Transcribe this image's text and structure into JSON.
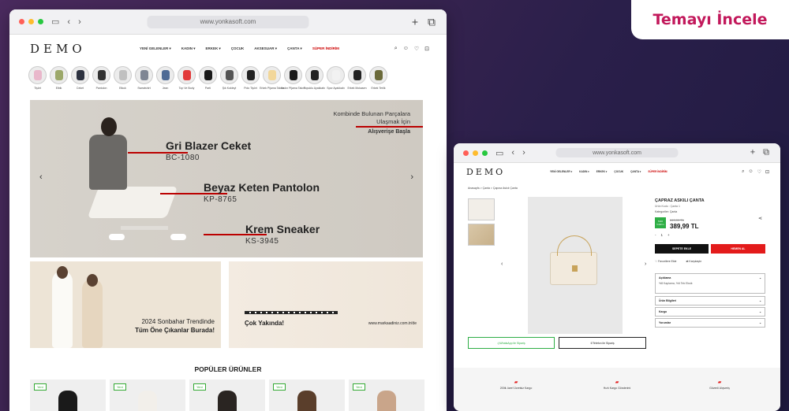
{
  "badge": {
    "label": "Temayı İncele"
  },
  "colors": {
    "accent_red": "#e31b1b",
    "badge_pink": "#c2185b",
    "green": "#2eae45"
  },
  "main_window": {
    "url": "www.yonkasoft.com",
    "logo": "DEMO",
    "nav": [
      "YENİ GELENLER ▾",
      "KADIN ▾",
      "ERKEK ▾",
      "ÇOCUK",
      "AKSESUAR ▾",
      "ÇANTA ▾",
      "SÜPER İNDİRİM"
    ],
    "header_icons": [
      "search-icon",
      "user-icon",
      "heart-icon",
      "cart-icon"
    ],
    "categories": [
      {
        "label": "Tişört",
        "color": "#e9b7cb"
      },
      {
        "label": "Elbik",
        "color": "#9ca86a"
      },
      {
        "label": "Ceket",
        "color": "#2d3240"
      },
      {
        "label": "Pantolon",
        "color": "#333"
      },
      {
        "label": "Etkuk",
        "color": "#c0c0c0"
      },
      {
        "label": "Sweatshirt",
        "color": "#7f8694"
      },
      {
        "label": "Jean",
        "color": "#4f6b95"
      },
      {
        "label": "Top Ve Body",
        "color": "#e23a3a"
      },
      {
        "label": "Parti",
        "color": "#1a1a1a"
      },
      {
        "label": "Şık Kokteyl",
        "color": "#555"
      },
      {
        "label": "Polo Tişört",
        "color": "#222"
      },
      {
        "label": "Erkek Pijama Takım",
        "color": "#f2d79a"
      },
      {
        "label": "Kadın Pijama Takım",
        "color": "#1a1a1a"
      },
      {
        "label": "Topuklu Ayakkabı",
        "color": "#222"
      },
      {
        "label": "Spor Ayakkabı",
        "color": "#f2f2f2"
      },
      {
        "label": "Erkek Mokasen",
        "color": "#222"
      },
      {
        "label": "Erkek Terlik",
        "color": "#6b6a3a"
      }
    ],
    "hero": {
      "right_text": "Kombinde Bulunan Parçalara Ulaşmak İçin",
      "cta": "Alışverişe Başla",
      "items": [
        {
          "name": "Gri Blazer Ceket",
          "code": "BC-1080"
        },
        {
          "name": "Beyaz Keten Pantolon",
          "code": "KP-8765"
        },
        {
          "name": "Krem Sneaker",
          "code": "KS-3945"
        }
      ],
      "prev_arrow": "‹",
      "next_arrow": "›"
    },
    "promo1": {
      "line1": "2024 Sonbahar Trendinde",
      "line2": "Tüm Öne Çıkanlar Burada!"
    },
    "promo2": {
      "title": "Çok Yakında!",
      "url": "www.markaadiniz.com.tr/de"
    },
    "popular_title": "POPÜLER ÜRÜNLER",
    "product_tag": "Yeni",
    "products": [
      {
        "color": "#1a1a1a"
      },
      {
        "color": "#f2efea"
      },
      {
        "color": "#2a2522"
      },
      {
        "color": "#5a3e2b"
      },
      {
        "color": "#c9a58a"
      }
    ]
  },
  "product_window": {
    "url": "www.yonkasoft.com",
    "logo": "DEMO",
    "nav": [
      "YENİ GELENLER ▾",
      "KADIN ▾",
      "ERKEK ▾",
      "ÇOCUK",
      "ÇANTA ▾",
      "SÜPER İNDİRİM"
    ],
    "breadcrumb": "Anasayfa > Çanta > Çapraz Askılı Çanta",
    "product": {
      "title": "ÇAPRAZ ASKILI ÇANTA",
      "subtitle": "Ürün Kodu : Çanta 1",
      "category_label": "Kategoriler: Çanta",
      "discount": "%40 İndirim",
      "old_price": "649,99 TL",
      "price": "389,99 TL",
      "qty_minus": "-",
      "qty": "1",
      "qty_plus": "+",
      "add_to_cart": "SEPETE EKLE",
      "buy_now": "HEMEN AL",
      "favorite": "Favorilere Ekle",
      "compare": "Karşılaştır"
    },
    "accordion": [
      {
        "title": "Açıklama",
        "body": "%8 Kaplama, %6 Tek Eksik"
      },
      {
        "title": "Ürün Bilgileri",
        "body": ""
      },
      {
        "title": "Kargo",
        "body": ""
      },
      {
        "title": "Yorumlar",
        "body": ""
      }
    ],
    "whatsapp": "WhatsApp ile Sipariş",
    "phone": "Telefon ile Sipariş",
    "features": [
      "200₺ üzeri Ücretsiz Kargo",
      "Hızlı Kargo Gönderimi",
      "Güvenli Alışveriş"
    ]
  }
}
